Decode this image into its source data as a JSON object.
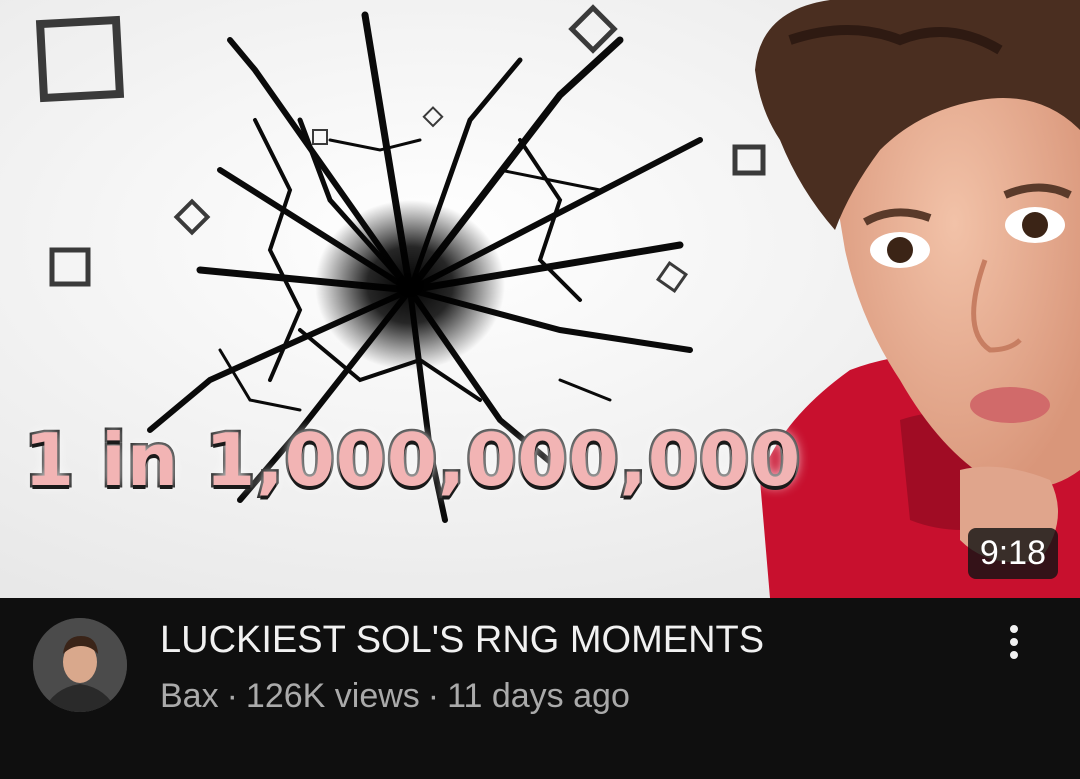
{
  "video": {
    "thumbnail_text": "1 in 1,000,000,000",
    "duration": "9:18",
    "title": "LUCKIEST SOL'S RNG MOMENTS",
    "channel": "Bax",
    "views": "126K views",
    "age": "11 days ago",
    "separator": "·",
    "more_icon": "vertical-dots-icon"
  },
  "colors": {
    "background": "#0f0f0f",
    "title_text": "#f1f1f1",
    "meta_text": "#aaaaaa",
    "thumbnail_text_fill": "#f2b4b4",
    "hoodie_red": "#c8102e"
  }
}
